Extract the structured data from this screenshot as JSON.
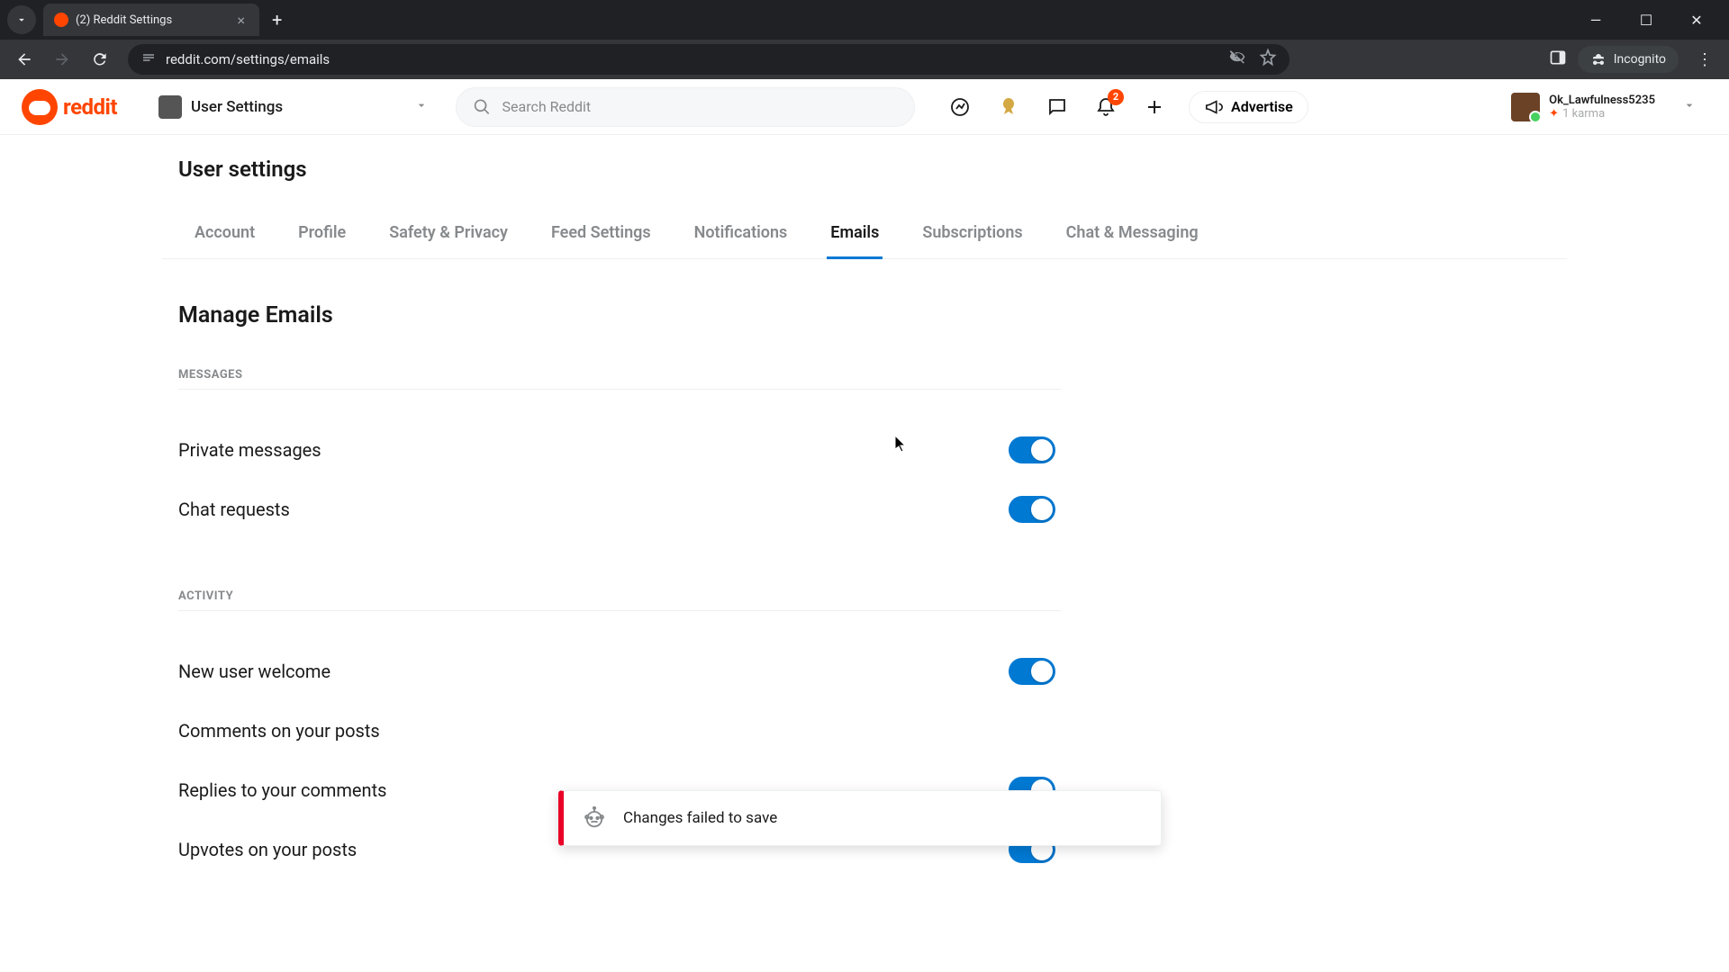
{
  "browser": {
    "tab_title": "(2) Reddit Settings",
    "url": "reddit.com/settings/emails",
    "incognito_label": "Incognito"
  },
  "header": {
    "logo_text": "reddit",
    "community_label": "User Settings",
    "search_placeholder": "Search Reddit",
    "notif_badge": "2",
    "advertise_label": "Advertise",
    "user": {
      "name": "Ok_Lawfulness5235",
      "karma": "1 karma"
    }
  },
  "page_title": "User settings",
  "tabs": [
    {
      "label": "Account",
      "active": false
    },
    {
      "label": "Profile",
      "active": false
    },
    {
      "label": "Safety & Privacy",
      "active": false
    },
    {
      "label": "Feed Settings",
      "active": false
    },
    {
      "label": "Notifications",
      "active": false
    },
    {
      "label": "Emails",
      "active": true
    },
    {
      "label": "Subscriptions",
      "active": false
    },
    {
      "label": "Chat & Messaging",
      "active": false
    }
  ],
  "section_title": "Manage Emails",
  "groups": [
    {
      "label": "Messages",
      "settings": [
        {
          "label": "Private messages",
          "on": true
        },
        {
          "label": "Chat requests",
          "on": true
        }
      ]
    },
    {
      "label": "Activity",
      "settings": [
        {
          "label": "New user welcome",
          "on": true
        },
        {
          "label": "Comments on your posts",
          "on": true
        },
        {
          "label": "Replies to your comments",
          "on": true
        },
        {
          "label": "Upvotes on your posts",
          "on": true
        }
      ]
    }
  ],
  "toast": {
    "message": "Changes failed to save"
  }
}
